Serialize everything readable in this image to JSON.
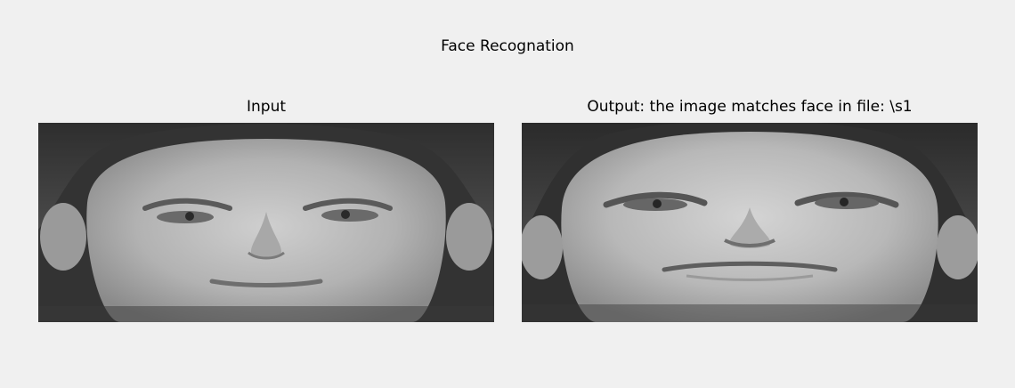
{
  "figure": {
    "title": "Face Recognation"
  },
  "panels": [
    {
      "title": "Input",
      "image": "face-photo-grayscale"
    },
    {
      "title": "Output: the image matches face in file: \\s1",
      "image": "face-photo-grayscale"
    }
  ],
  "colors": {
    "window_bg": "#f0f0f0",
    "image_bg": "#3a3a3a"
  }
}
